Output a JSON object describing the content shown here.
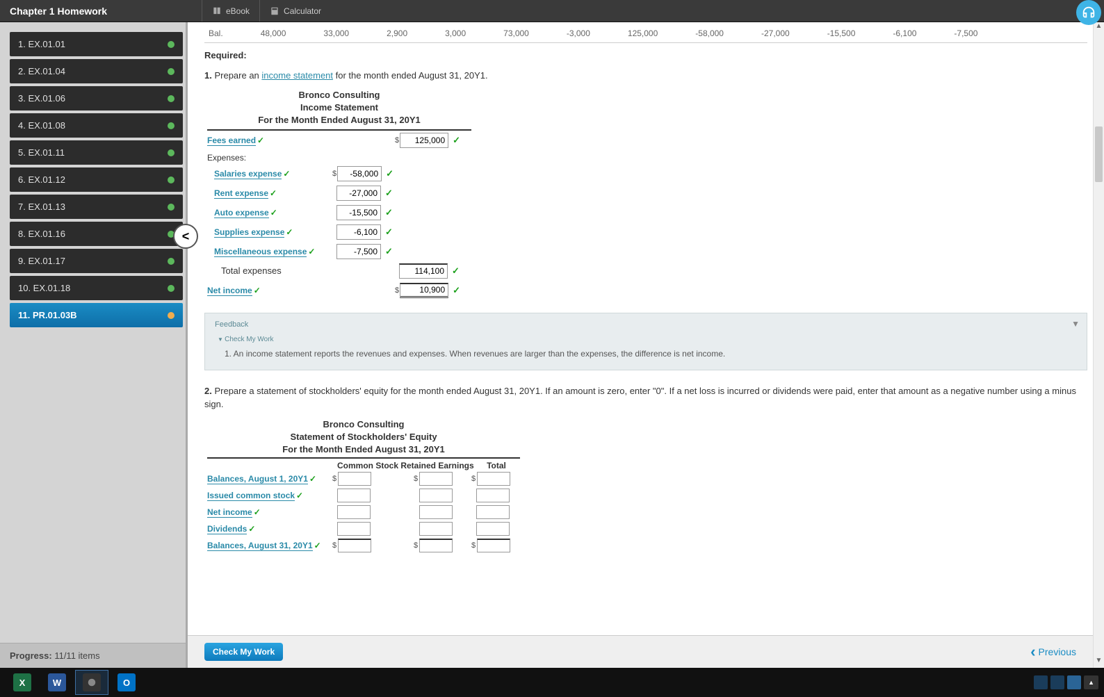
{
  "topbar": {
    "title": "Chapter 1 Homework",
    "ebook": "eBook",
    "calculator": "Calculator"
  },
  "sidebar": {
    "items": [
      {
        "label": "1. EX.01.01",
        "status": "done"
      },
      {
        "label": "2. EX.01.04",
        "status": "done"
      },
      {
        "label": "3. EX.01.06",
        "status": "done"
      },
      {
        "label": "4. EX.01.08",
        "status": "done"
      },
      {
        "label": "5. EX.01.11",
        "status": "done"
      },
      {
        "label": "6. EX.01.12",
        "status": "done"
      },
      {
        "label": "7. EX.01.13",
        "status": "done"
      },
      {
        "label": "8. EX.01.16",
        "status": "done"
      },
      {
        "label": "9. EX.01.17",
        "status": "done"
      },
      {
        "label": "10. EX.01.18",
        "status": "done"
      },
      {
        "label": "11. PR.01.03B",
        "status": "partial",
        "active": true
      }
    ],
    "progress_label": "Progress:",
    "progress_value": "11/11 items"
  },
  "balance_row": [
    "Bal.",
    "48,000",
    "33,000",
    "2,900",
    "3,000",
    "73,000",
    "-3,000",
    "125,000",
    "-58,000",
    "-27,000",
    "-15,500",
    "-6,100",
    "-7,500"
  ],
  "content": {
    "required": "Required:",
    "q1_num": "1.",
    "q1_text_a": "Prepare an ",
    "q1_link": "income statement",
    "q1_text_b": " for the month ended August 31, 20Y1.",
    "stmt1": {
      "company": "Bronco Consulting",
      "title": "Income Statement",
      "period": "For the Month Ended August 31, 20Y1",
      "fees_label": "Fees earned",
      "fees_value": "125,000",
      "expenses_header": "Expenses:",
      "expenses": [
        {
          "label": "Salaries expense",
          "value": "-58,000"
        },
        {
          "label": "Rent expense",
          "value": "-27,000"
        },
        {
          "label": "Auto expense",
          "value": "-15,500"
        },
        {
          "label": "Supplies expense",
          "value": "-6,100"
        },
        {
          "label": "Miscellaneous expense",
          "value": "-7,500"
        }
      ],
      "total_exp_label": "Total expenses",
      "total_exp_value": "114,100",
      "net_label": "Net income",
      "net_value": "10,900"
    },
    "feedback": {
      "title": "Feedback",
      "cmw": "Check My Work",
      "text": "1. An income statement reports the revenues and expenses. When revenues are larger than the expenses, the difference is net income."
    },
    "q2_num": "2.",
    "q2_text": "Prepare a statement of stockholders' equity for the month ended August 31, 20Y1. If an amount is zero, enter \"0\". If a net loss is incurred or dividends were paid, enter that amount as a negative number using a minus sign.",
    "stmt2": {
      "company": "Bronco Consulting",
      "title": "Statement of Stockholders' Equity",
      "period": "For the Month Ended August 31, 20Y1",
      "cols": [
        "Common Stock",
        "Retained Earnings",
        "Total"
      ],
      "rows": [
        "Balances, August 1, 20Y1",
        "Issued common stock",
        "Net income",
        "Dividends",
        "Balances, August 31, 20Y1"
      ]
    }
  },
  "footer": {
    "check_btn": "Check My Work",
    "previous": "Previous"
  }
}
